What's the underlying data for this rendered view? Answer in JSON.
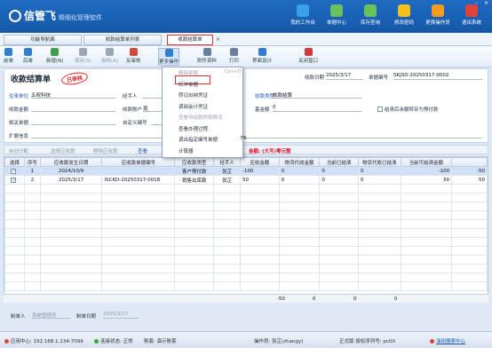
{
  "app": {
    "logo": "信管飞",
    "logo_tag": "精细化管理软件",
    "topnav": [
      {
        "label": "我的工作台",
        "icon": "desk-icon",
        "color": "#3aa0e8"
      },
      {
        "label": "单据中心",
        "icon": "docs-icon",
        "color": "#69c15b"
      },
      {
        "label": "库存查询",
        "icon": "stock-icon",
        "color": "#69c15b"
      },
      {
        "label": "修改密码",
        "icon": "lock-icon",
        "color": "#f2c11c"
      },
      {
        "label": "更换操作员",
        "icon": "user-icon",
        "color": "#f29b1c"
      },
      {
        "label": "退出系统",
        "icon": "exit-icon",
        "color": "#e0433a"
      }
    ]
  },
  "tabs": [
    "功能导航面",
    "收款结算单列表",
    "收款结算单"
  ],
  "toolbar": [
    {
      "label": "前单",
      "icon": "prev-icon",
      "dim": false
    },
    {
      "label": "后单",
      "icon": "next-icon",
      "dim": false
    },
    {
      "label": "新增(N)",
      "icon": "add-icon",
      "dim": false
    },
    {
      "label": "保存(S)",
      "icon": "save-icon",
      "dim": true
    },
    {
      "label": "审核(A)",
      "icon": "audit-icon",
      "dim": true
    },
    {
      "label": "反审核",
      "icon": "unaudit-icon",
      "dim": false
    },
    {
      "label": "更多操作",
      "icon": "more-icon",
      "dim": false
    },
    {
      "label": "附件资料",
      "icon": "attach-icon",
      "dim": false
    },
    {
      "label": "打印",
      "icon": "print-icon",
      "dim": false
    },
    {
      "label": "界面设计",
      "icon": "design-icon",
      "dim": false
    },
    {
      "label": "关闭窗口",
      "icon": "close-window-icon",
      "dim": false
    }
  ],
  "form": {
    "title": "收款结算单",
    "stamp": "已审核",
    "date_label": "收款日期",
    "date_value": "2025/3/17",
    "no_label": "单据编号",
    "no_value": "SKJSD-20250317-0002",
    "unit_label": "往来单位",
    "unit_value": "五祝科技",
    "handler_label": "经手人",
    "type_label": "收款类型",
    "type_value": "收款结算",
    "amount_label": "收款金额",
    "account_label": "收款账户",
    "account_value": "现",
    "fund_label": "基金额",
    "fund_value": "0",
    "ref_label": "相关单据",
    "custom_label": "自定义编号",
    "remark_label": "扩展信息",
    "checkbox_label": "结清后余额转存为预付款"
  },
  "menu": {
    "items": [
      {
        "label": "删除单据",
        "shortcut": "Ctrl+D",
        "dim": true
      },
      {
        "label": "红冲单据",
        "shortcut": "",
        "dim": false
      },
      {
        "label": "转记出纳凭证",
        "shortcut": "",
        "dim": false
      },
      {
        "label": "调阅会计凭证",
        "shortcut": "",
        "dim": false
      },
      {
        "label": "查看待结款核销情况",
        "shortcut": "",
        "dim": true
      },
      {
        "label": "查看办理过程",
        "shortcut": "",
        "dim": false
      },
      {
        "label": "调出指定编号单据",
        "shortcut": "F6",
        "dim": false
      },
      {
        "label": "计算器",
        "shortcut": "",
        "dim": false
      }
    ]
  },
  "grid_toolbar": {
    "auto": "自动分配",
    "select": "选择应收款",
    "delete": "删除应收款",
    "view": "查看",
    "note": "金额: (大写)零元整"
  },
  "table": {
    "headers": [
      "选择",
      "序号",
      "应收款发生日期",
      "应收款单据编号",
      "应收款类型",
      "经手人",
      "应收金额",
      "物流代收金额",
      "当前已结清",
      "物流代收已结清",
      "当前可结清金额",
      ""
    ],
    "rows": [
      [
        "",
        "1",
        "2024/10/9",
        "",
        "客户预付款",
        "张芷",
        "-100",
        "0",
        "0",
        "0",
        "-100",
        "-50"
      ],
      [
        "",
        "2",
        "2025/3/17",
        "ISCKD-20250317-0018",
        "销售出库款",
        "张芷",
        "50",
        "0",
        "0",
        "0",
        "50",
        "50"
      ]
    ],
    "totals": [
      "-50",
      "0",
      "0",
      "0"
    ]
  },
  "maker": {
    "maker_label": "制单人",
    "maker_value": "系统管理员",
    "date_label": "制单日期",
    "date_value": "2025/3/17"
  },
  "status": {
    "server": "应用中心: 192.168.1.134:7099",
    "conn": "连接状态: 正常",
    "company": "账套: 演示账套",
    "operator": "操作员: 张芷(zhangy)",
    "license": "正式版  授权序列号: pc0X",
    "help": "油田搜索中心"
  }
}
